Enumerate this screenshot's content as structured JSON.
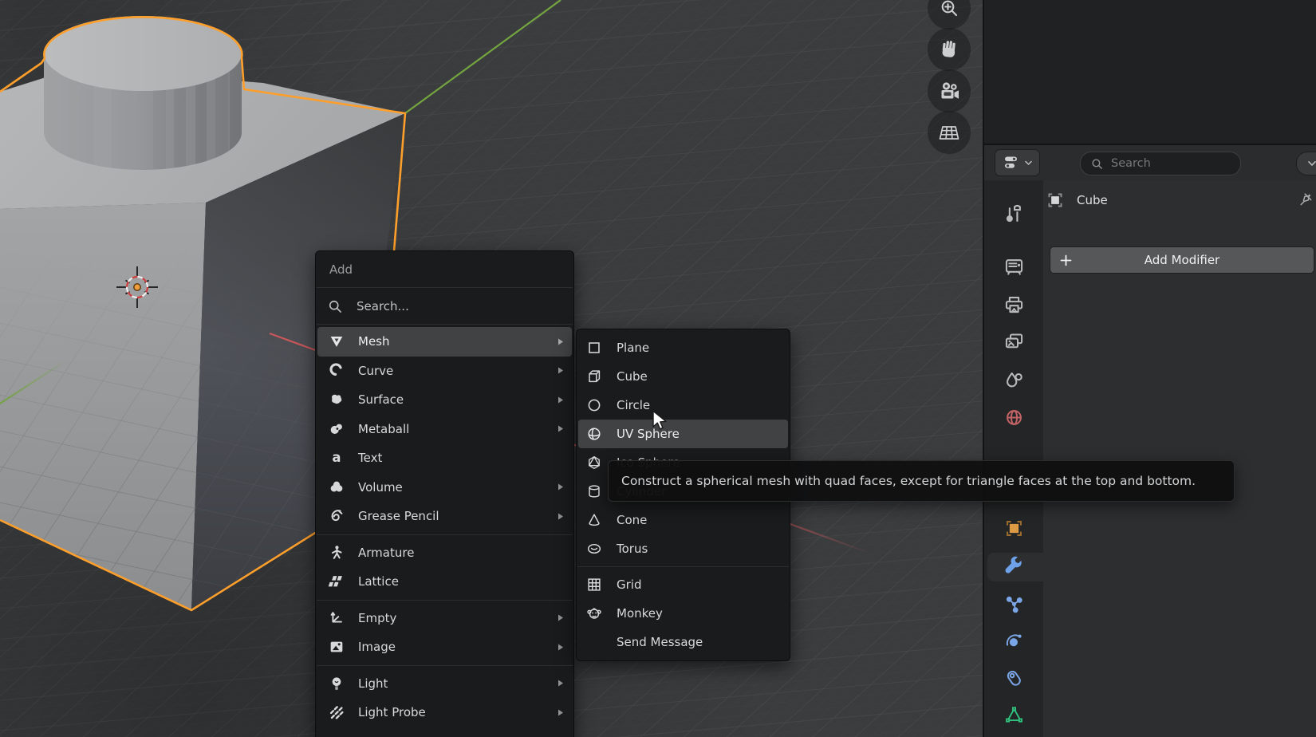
{
  "viewport": {
    "selected_object_outline_color": "#ff9f2b",
    "axis_x_color": "#c9575a",
    "axis_y_color": "#73a43f",
    "cursor_tool": "3d-cursor"
  },
  "add_menu": {
    "title": "Add",
    "search_placeholder": "Search...",
    "items": [
      {
        "label": "Mesh",
        "icon": "mesh-icon",
        "has_submenu": true,
        "highlighted": true
      },
      {
        "label": "Curve",
        "icon": "curve-icon",
        "has_submenu": true
      },
      {
        "label": "Surface",
        "icon": "surface-icon",
        "has_submenu": true
      },
      {
        "label": "Metaball",
        "icon": "metaball-icon",
        "has_submenu": true
      },
      {
        "label": "Text",
        "icon": "text-icon",
        "has_submenu": false
      },
      {
        "label": "Volume",
        "icon": "volume-icon",
        "has_submenu": true
      },
      {
        "label": "Grease Pencil",
        "icon": "grease-pencil-icon",
        "has_submenu": true
      },
      {
        "label": "Armature",
        "icon": "armature-icon",
        "has_submenu": false
      },
      {
        "label": "Lattice",
        "icon": "lattice-icon",
        "has_submenu": false
      },
      {
        "label": "Empty",
        "icon": "empty-icon",
        "has_submenu": true
      },
      {
        "label": "Image",
        "icon": "image-icon",
        "has_submenu": true
      },
      {
        "label": "Light",
        "icon": "light-icon",
        "has_submenu": true
      },
      {
        "label": "Light Probe",
        "icon": "light-probe-icon",
        "has_submenu": true
      }
    ]
  },
  "mesh_submenu": {
    "items": [
      {
        "label": "Plane",
        "icon": "plane-icon"
      },
      {
        "label": "Cube",
        "icon": "cube-icon"
      },
      {
        "label": "Circle",
        "icon": "circle-icon"
      },
      {
        "label": "UV Sphere",
        "icon": "uv-sphere-icon",
        "highlighted": true
      },
      {
        "label": "Ico Sphere",
        "icon": "ico-sphere-icon"
      },
      {
        "label": "Cylinder",
        "icon": "cylinder-icon",
        "occluded_by_tooltip": true
      },
      {
        "label": "Cone",
        "icon": "cone-icon"
      },
      {
        "label": "Torus",
        "icon": "torus-icon"
      },
      {
        "label": "Grid",
        "icon": "grid-icon"
      },
      {
        "label": "Monkey",
        "icon": "monkey-icon"
      },
      {
        "label": "Send Message",
        "icon": null
      }
    ]
  },
  "tooltip": {
    "text": "Construct a spherical mesh with quad faces, except for triangle faces at the top and bottom."
  },
  "properties_panel": {
    "search_placeholder": "Search",
    "breadcrumb_object": "Cube",
    "add_modifier_label": "Add Modifier",
    "tabs": [
      {
        "name": "tool",
        "icon": "tool-icon"
      },
      {
        "name": "render",
        "icon": "render-icon"
      },
      {
        "name": "output",
        "icon": "output-icon"
      },
      {
        "name": "view-layer",
        "icon": "view-layer-icon"
      },
      {
        "name": "scene",
        "icon": "scene-icon"
      },
      {
        "name": "world",
        "icon": "world-icon",
        "color": "#c26366"
      },
      {
        "name": "object",
        "icon": "object-icon",
        "color": "#dd9a44"
      },
      {
        "name": "modifiers",
        "icon": "modifier-wrench-icon",
        "color": "#6da1e8",
        "active": true
      },
      {
        "name": "particles",
        "icon": "particles-icon",
        "color": "#7aa5e6"
      },
      {
        "name": "physics",
        "icon": "physics-icon",
        "color": "#7aa5e6"
      },
      {
        "name": "constraints",
        "icon": "constraint-icon",
        "color": "#7aa5e6"
      },
      {
        "name": "object-data",
        "icon": "object-data-icon",
        "color": "#2ec27e"
      }
    ]
  },
  "gizmos": [
    {
      "name": "zoom",
      "icon": "zoom-icon"
    },
    {
      "name": "pan",
      "icon": "hand-icon"
    },
    {
      "name": "camera",
      "icon": "camera-icon"
    },
    {
      "name": "grid",
      "icon": "grid-perspective-icon"
    }
  ]
}
